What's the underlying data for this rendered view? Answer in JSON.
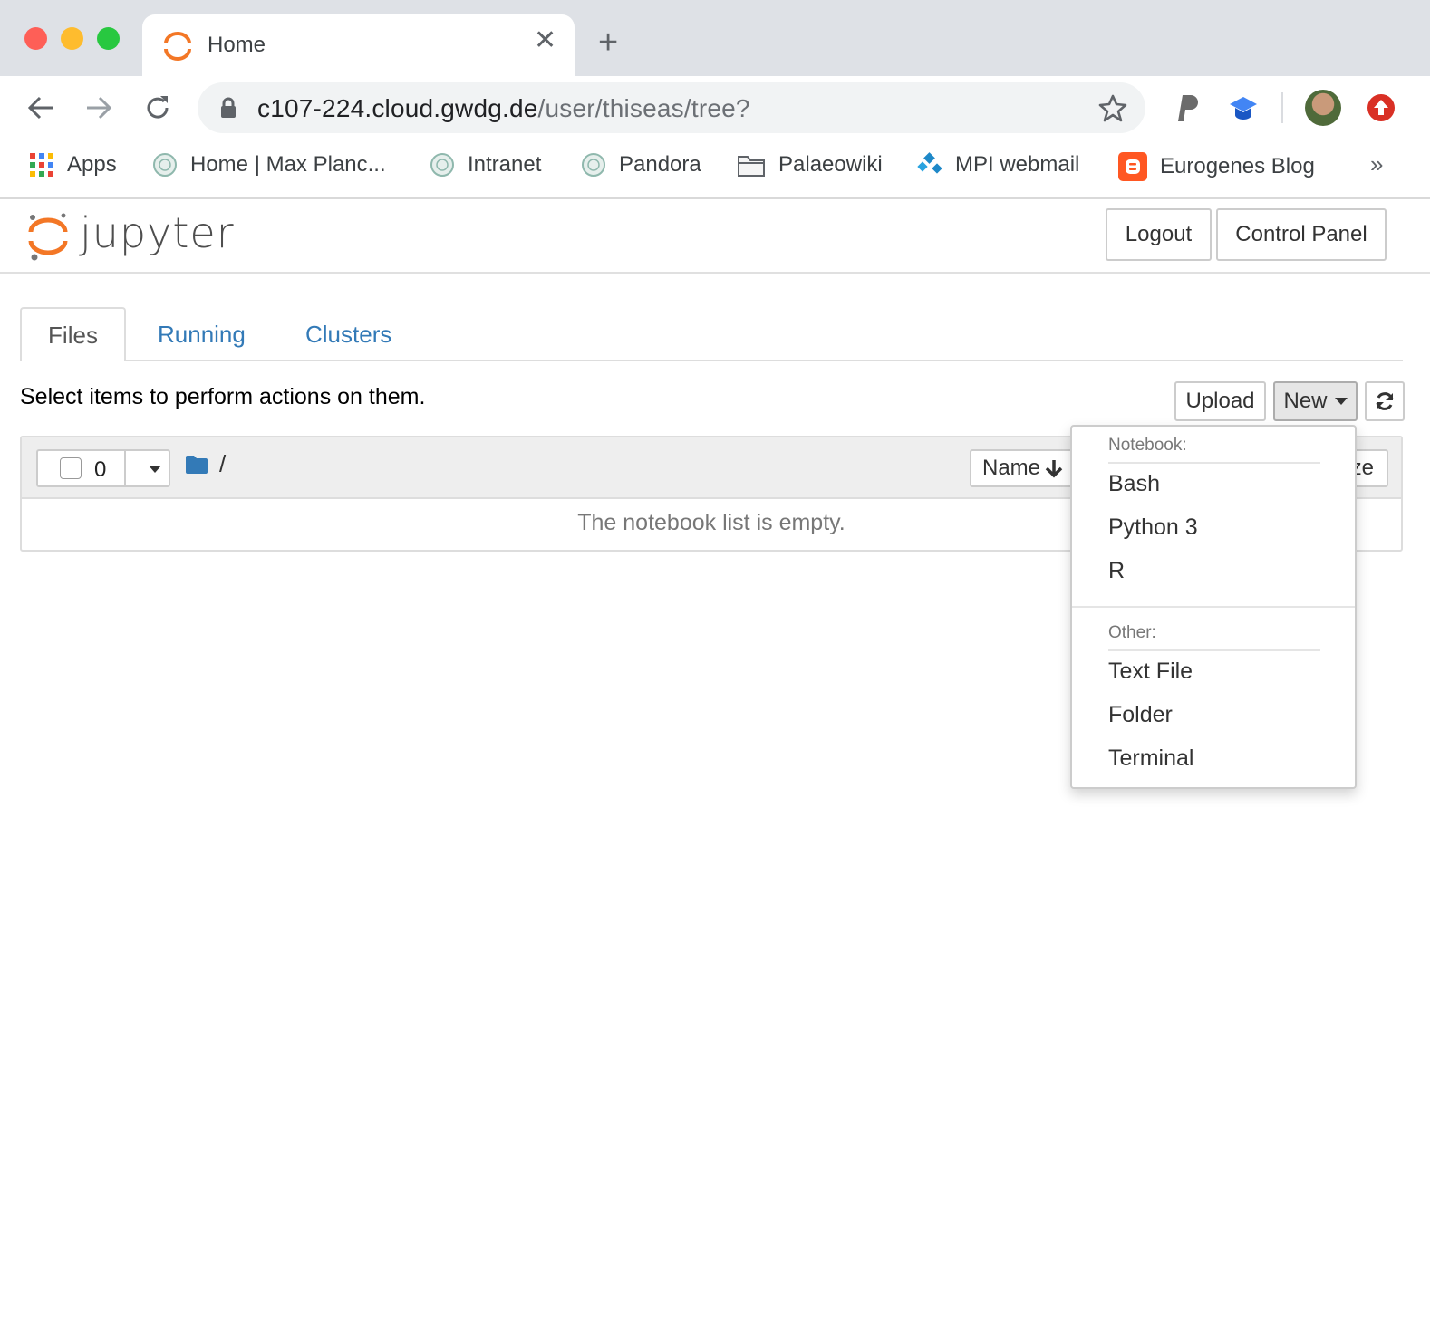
{
  "browser": {
    "tab_title": "Home",
    "new_tab_symbol": "+",
    "close_symbol": "✕",
    "url_host": "c107-224.cloud.gwdg.de",
    "url_path": "/user/thiseas/tree?",
    "bookmarks": [
      {
        "label": "Apps"
      },
      {
        "label": "Home | Max Planc..."
      },
      {
        "label": "Intranet"
      },
      {
        "label": "Pandora"
      },
      {
        "label": "Palaeowiki"
      },
      {
        "label": "MPI webmail"
      },
      {
        "label": "Eurogenes Blog"
      }
    ],
    "overflow_symbol": "»"
  },
  "jupyter": {
    "logo_text": "jupyter",
    "logout_label": "Logout",
    "control_panel_label": "Control Panel",
    "tabs": [
      {
        "label": "Files",
        "active": true
      },
      {
        "label": "Running",
        "active": false
      },
      {
        "label": "Clusters",
        "active": false
      }
    ],
    "hint": "Select items to perform actions on them.",
    "upload_label": "Upload",
    "new_label": "New",
    "selected_count": "0",
    "root_path": "/",
    "sort_name_label": "Name",
    "sort_size_label": "ze",
    "empty_message": "The notebook list is empty."
  },
  "dropdown": {
    "notebook_header": "Notebook:",
    "notebook_items": [
      "Bash",
      "Python 3",
      "R"
    ],
    "other_header": "Other:",
    "other_items": [
      "Text File",
      "Folder",
      "Terminal"
    ]
  },
  "colors": {
    "tabstrip": "#dee1e6",
    "link": "#337ab7",
    "jupyter_orange": "#f37726"
  }
}
